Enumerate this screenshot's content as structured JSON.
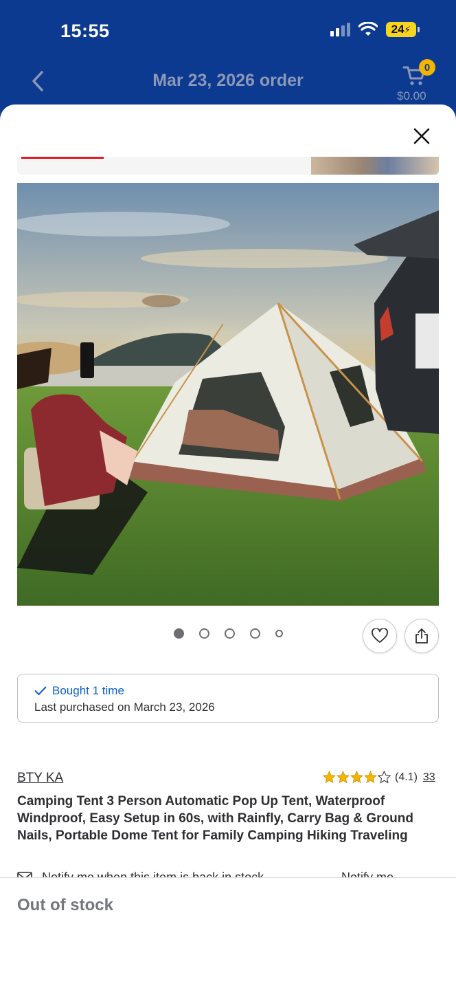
{
  "status_bar": {
    "time": "15:55",
    "battery": "24"
  },
  "header": {
    "title": "Mar 23, 2026 order",
    "cart_count": "0",
    "cart_total": "$0.00"
  },
  "icons": {
    "back": "chevron-left-icon",
    "cart": "cart-icon",
    "close": "close-icon",
    "favorite": "heart-icon",
    "share": "share-icon",
    "check": "checkmark-icon",
    "mail": "mail-icon"
  },
  "carousel": {
    "dot_count": 5,
    "active_index": 0
  },
  "purchase_history": {
    "bought_label": "Bought 1 time",
    "last_purchased": "Last purchased on March 23, 2026"
  },
  "product": {
    "brand": "BTY KA",
    "rating_value": "(4.1)",
    "rating_stars": 4.1,
    "review_count": "33",
    "title": "Camping Tent 3 Person Automatic Pop Up Tent, Waterproof Windproof, Easy Setup in 60s, with Rainfly, Carry Bag & Ground Nails, Portable Dome Tent for Family Camping Hiking Traveling"
  },
  "notify": {
    "text": "Notify me when this item is back in stock",
    "link": "Notify me"
  },
  "footer": {
    "stock_status": "Out of stock"
  },
  "colors": {
    "header_bg": "#0d3a91",
    "link_blue": "#0d5fd3",
    "star": "#f4b400",
    "badge": "#f4b400"
  }
}
